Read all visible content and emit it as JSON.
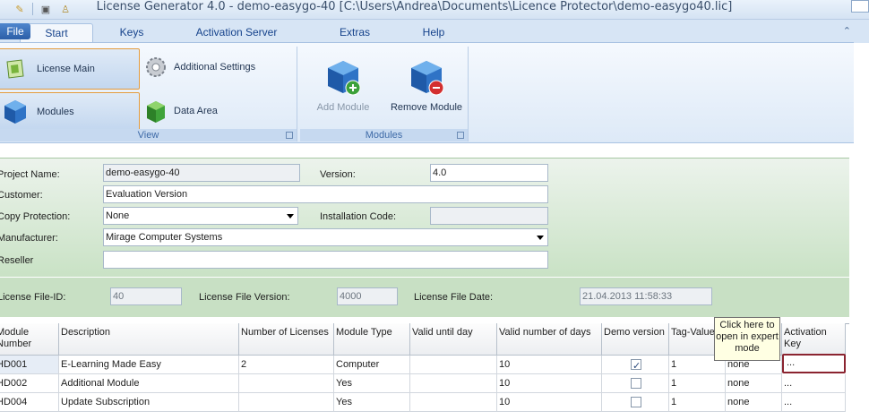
{
  "app": {
    "title": "License Generator 4.0  -  demo-easygo-40  [C:\\Users\\Andrea\\Documents\\Licence Protector\\demo-easygo40.lic]"
  },
  "tabs": {
    "file": "File",
    "start": "Start",
    "keys": "Keys",
    "activation_server": "Activation Server",
    "extras": "Extras",
    "help": "Help"
  },
  "ribbon": {
    "view": {
      "label": "View",
      "license_main": "License Main",
      "modules": "Modules",
      "additional_settings": "Additional Settings",
      "data_area": "Data Area"
    },
    "modules_group": {
      "label": "Modules",
      "add_module": "Add Module",
      "remove_module": "Remove Module"
    }
  },
  "form": {
    "project_name_label": "Project Name:",
    "project_name": "demo-easygo-40",
    "version_label": "Version:",
    "version": "4.0",
    "customer_label": "Customer:",
    "customer": "Evaluation Version",
    "copy_protection_label": "Copy Protection:",
    "copy_protection": "None",
    "installation_code_label": "Installation Code:",
    "installation_code": "",
    "manufacturer_label": "Manufacturer:",
    "manufacturer": "Mirage Computer Systems",
    "reseller_label": "Reseller",
    "reseller": ""
  },
  "license_ids": {
    "file_id_label": "License File-ID:",
    "file_id": "40",
    "file_version_label": "License File Version:",
    "file_version": "4000",
    "file_date_label": "License File Date:",
    "file_date": "21.04.2013 11:58:33"
  },
  "grid": {
    "headers": {
      "module_number": "Module Number",
      "description": "Description",
      "number_of_licenses": "Number of Licenses",
      "module_type": "Module Type",
      "valid_until_day": "Valid until day",
      "valid_number_of_days": "Valid number of days",
      "demo_version": "Demo version",
      "tag_value": "Tag-Value",
      "activation_key": "Activation Key"
    },
    "rows": [
      {
        "module": "HD001",
        "description": "E-Learning Made Easy",
        "licenses": "2",
        "type": "Computer",
        "until": "",
        "days": "10",
        "demo": true,
        "tag": "1",
        "none": "none",
        "key": "..."
      },
      {
        "module": "HD002",
        "description": "Additional Module",
        "licenses": "",
        "type": "Yes",
        "until": "",
        "days": "10",
        "demo": false,
        "tag": "1",
        "none": "none",
        "key": "..."
      },
      {
        "module": "HD004",
        "description": "Update Subscription",
        "licenses": "",
        "type": "Yes",
        "until": "",
        "days": "10",
        "demo": false,
        "tag": "1",
        "none": "none",
        "key": "..."
      }
    ],
    "tooltip": "Click here to open in expert mode"
  }
}
